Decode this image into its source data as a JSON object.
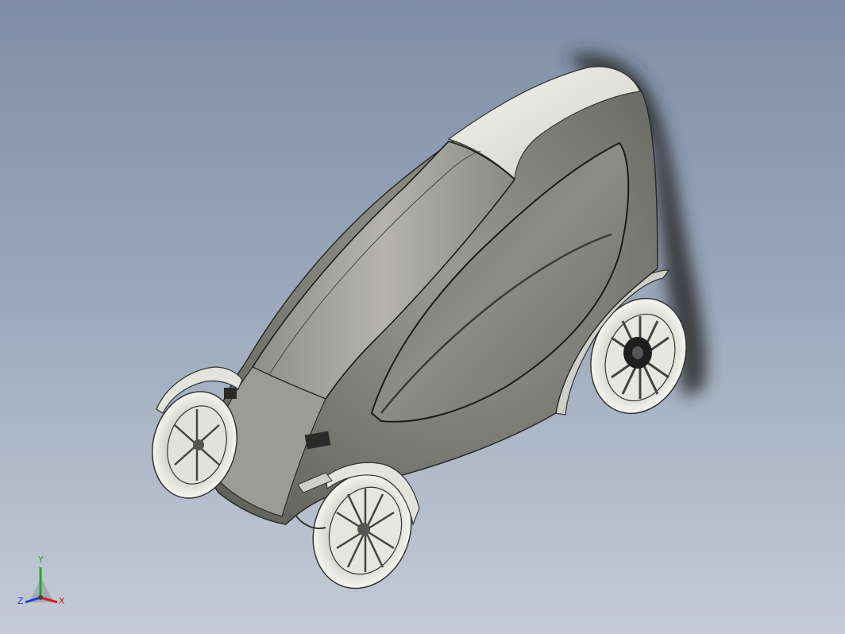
{
  "viewport": {
    "background_top": "#7f8ea7",
    "background_bottom": "#c4cbd6",
    "model": "three-wheel-vehicle-shaded"
  },
  "triad": {
    "x_label": "X",
    "y_label": "Y",
    "z_label": "Z",
    "x_color": "#d62020",
    "y_color": "#22a522",
    "z_color": "#2040d0"
  }
}
